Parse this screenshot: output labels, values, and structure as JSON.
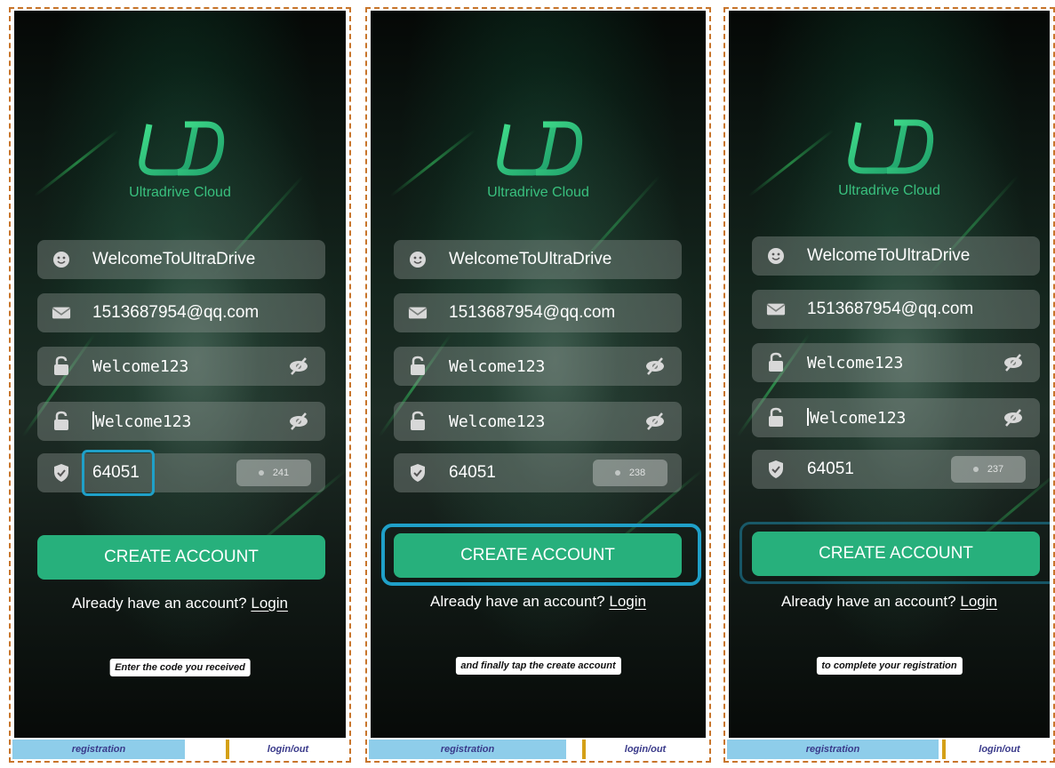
{
  "app": {
    "brand_name": "Ultradrive Cloud",
    "logo_text": "UD"
  },
  "form": {
    "username": "WelcomeToUltraDrive",
    "email": "1513687954@qq.com",
    "password": "Welcome123",
    "confirm_password": "elcome123",
    "confirm_password_prefix": "W",
    "verification_code": "64051"
  },
  "buttons": {
    "create_account": "CREATE ACCOUNT"
  },
  "footer": {
    "already_text": "Already have an account?",
    "login_link": "Login"
  },
  "tabs": {
    "registration": "registration",
    "login_out": "login/out"
  },
  "panels": [
    {
      "countdown": "241",
      "caption": "Enter the code you received"
    },
    {
      "countdown": "238",
      "caption": "and finally tap the create account"
    },
    {
      "countdown": "237",
      "caption": "to complete your registration"
    }
  ],
  "icons": [
    "user-face-icon",
    "mail-icon",
    "lock-icon",
    "eye-slash-icon",
    "shield-check-icon"
  ],
  "colors": {
    "accent_green": "#27b07c",
    "brand_text": "#39c07e",
    "focus_highlight": "#1fa0c8",
    "tab_registration": "#8ecdea"
  }
}
